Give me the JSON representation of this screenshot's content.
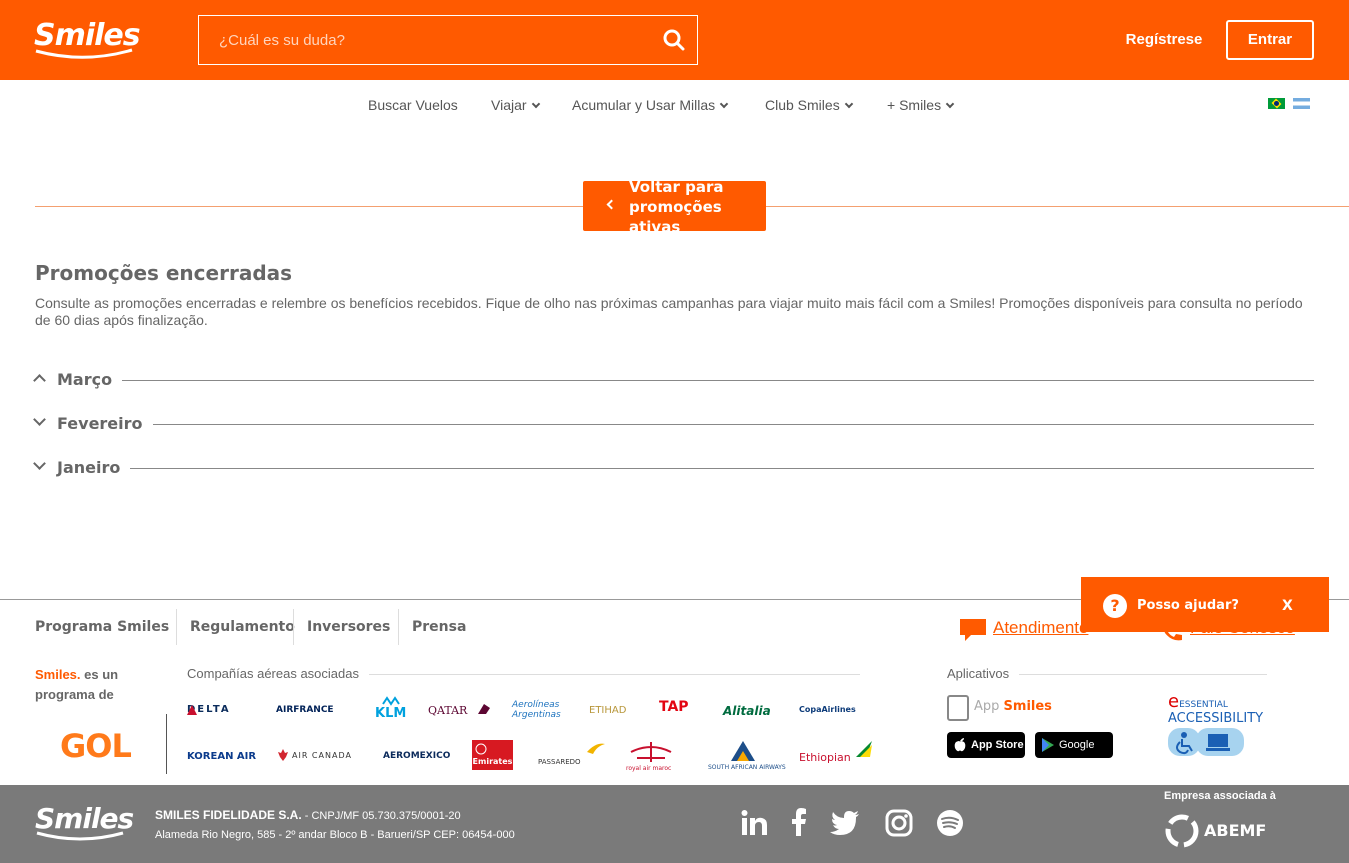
{
  "header": {
    "logo": "Smiles",
    "search_placeholder": "¿Cuál es su duda?",
    "register": "Regístrese",
    "login": "Entrar"
  },
  "nav": {
    "items": [
      {
        "label": "Buscar Vuelos"
      },
      {
        "label": "Viajar"
      },
      {
        "label": "Acumular y Usar Millas"
      },
      {
        "label": "Club Smiles"
      },
      {
        "label": "+ Smiles"
      }
    ]
  },
  "back_button": "Voltar para promoções ativas",
  "page": {
    "title": "Promoções encerradas",
    "description": "Consulte as promoções encerradas e relembre os benefícios recebidos. Fique de olho nas próximas campanhas para viajar muito mais fácil com a Smiles! Promoções disponíveis para consulta no período de 60 dias após finalização."
  },
  "accordion": [
    {
      "label": "Março",
      "expanded": true
    },
    {
      "label": "Fevereiro",
      "expanded": false
    },
    {
      "label": "Janeiro",
      "expanded": false
    }
  ],
  "footer": {
    "links": [
      "Programa Smiles",
      "Regulamento",
      "Inversores",
      "Prensa"
    ],
    "atendimento": "Atendimento",
    "phone_link": "Fale Conosco",
    "help": {
      "label": "Posso ajudar?",
      "close": "X"
    },
    "smiles_program_brand": "Smiles.",
    "smiles_program_text": "es un programa de",
    "gol": "GOL",
    "airlines_title": "Compañías aéreas asociadas",
    "airlines_row1": [
      "DELTA",
      "AIRFRANCE",
      "KLM",
      "QATAR",
      "Aerolíneas Argentinas",
      "ETIHAD",
      "TAP",
      "Alitalia",
      "CopaAirlines"
    ],
    "airlines_row2": [
      "KOREAN AIR",
      "AIR CANADA",
      "AEROMEXICO",
      "Emirates",
      "PASSAREDO",
      "royal air maroc",
      "SOUTH AFRICAN AIRWAYS",
      "Ethiopian"
    ],
    "apps_title": "Aplicativos",
    "app_smiles_prefix": "App",
    "app_smiles_brand": "Smiles",
    "app_store": "App Store",
    "google_play": "Google play",
    "essential": "ESSENTIAL",
    "accessibility": "ACCESSIBILITY"
  },
  "bottom": {
    "logo": "Smiles",
    "company_name": "SMILES FIDELIDADE S.A.",
    "company_cnpj": " - CNPJ/MF 05.730.375/0001-20",
    "address": "Alameda Rio Negro, 585 - 2º andar Bloco B - Barueri/SP CEP: 06454-000",
    "abemf_label": "Empresa associada à",
    "abemf": "ABEMF"
  },
  "colors": {
    "brand_orange": "#ff5a00",
    "footer_gray": "#7a7a7a"
  },
  "icons": [
    "search-icon",
    "chevron-down-icon",
    "chevron-left-icon",
    "chevron-up-icon",
    "chat-icon",
    "phone-icon",
    "question-icon",
    "linkedin-icon",
    "facebook-icon",
    "twitter-icon",
    "instagram-icon",
    "spotify-icon"
  ]
}
